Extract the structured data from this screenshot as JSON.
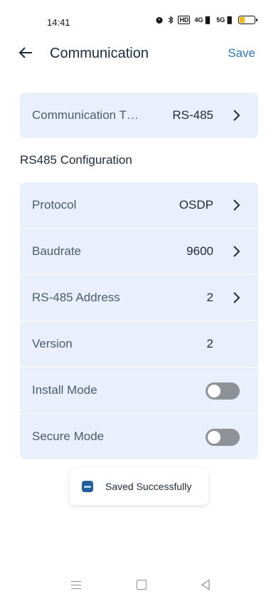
{
  "status_bar": {
    "time": "14:41",
    "hd": "HD",
    "net1": "4G",
    "net2": "5G"
  },
  "header": {
    "title": "Communication",
    "save_label": "Save"
  },
  "comm_type": {
    "label": "Communication T…",
    "value": "RS-485"
  },
  "section_title": "RS485 Configuration",
  "rows": [
    {
      "label": "Protocol",
      "value": "OSDP"
    },
    {
      "label": "Baudrate",
      "value": "9600"
    },
    {
      "label": "RS-485 Address",
      "value": "2"
    },
    {
      "label": "Version",
      "value": "2"
    },
    {
      "label": "Install Mode",
      "toggle_on": false
    },
    {
      "label": "Secure Mode",
      "toggle_on": false
    }
  ],
  "toast": {
    "message": "Saved Successfully"
  },
  "colors": {
    "accent": "#2d74c4",
    "card_bg": "#e9f0fb",
    "toggle_off": "#8e9196",
    "battery": "#f5b800"
  }
}
